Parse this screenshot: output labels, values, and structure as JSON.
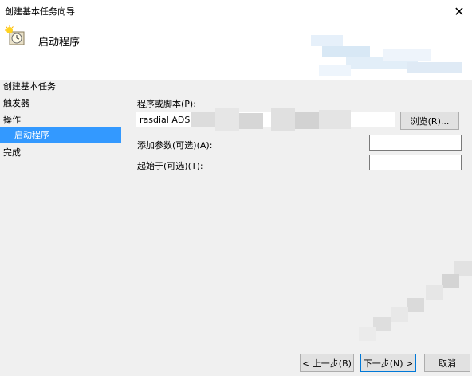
{
  "window": {
    "title": "创建基本任务向导",
    "close_glyph": "✕"
  },
  "header": {
    "heading": "启动程序"
  },
  "nav": {
    "items": [
      {
        "label": "创建基本任务"
      },
      {
        "label": "触发器"
      },
      {
        "label": "操作"
      },
      {
        "label": "启动程序"
      },
      {
        "label": "完成"
      }
    ]
  },
  "form": {
    "program_label": "程序或脚本(P):",
    "program_value": "rasdial ADSL",
    "browse_label": "浏览(R)...",
    "args_label": "添加参数(可选)(A):",
    "args_value": "",
    "startin_label": "起始于(可选)(T):",
    "startin_value": ""
  },
  "footer": {
    "back_label": "< 上一步(B)",
    "next_label": "下一步(N) >",
    "cancel_label": "取消"
  },
  "colors": {
    "selection": "#3399ff",
    "focus_border": "#0078d7"
  },
  "icons": {
    "wizard": "task-clock-icon",
    "close": "close-icon"
  }
}
